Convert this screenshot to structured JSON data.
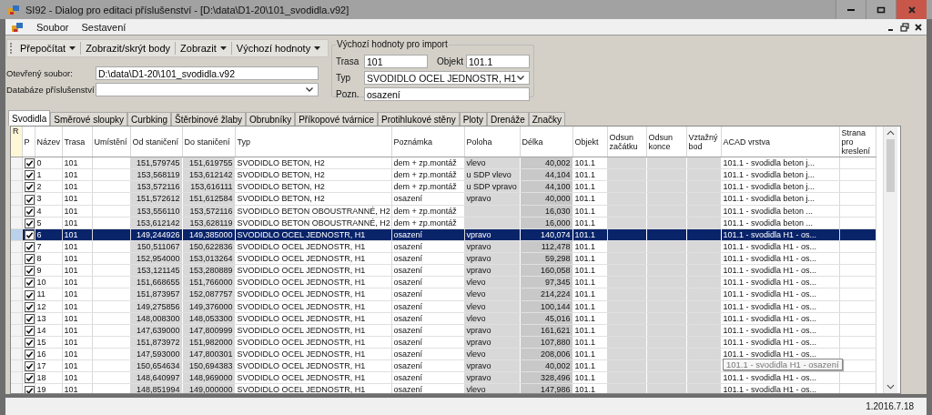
{
  "window": {
    "title": "SI92 - Dialog pro editaci příslušenství - [D:\\data\\D1-20\\101_svodidla.v92]"
  },
  "menu": [
    "Soubor",
    "Sestavení"
  ],
  "toolbar": [
    {
      "label": "Přepočítat",
      "dropdown": true
    },
    {
      "label": "Zobrazit/skrýt body",
      "dropdown": false
    },
    {
      "label": "Zobrazit",
      "dropdown": true
    },
    {
      "label": "Výchozí hodnoty",
      "dropdown": true
    }
  ],
  "fields": [
    {
      "label": "Otevřený soubor:",
      "value": "D:\\data\\D1-20\\101_svodidla.v92",
      "kind": "text"
    },
    {
      "label": "Databáze příslušenství",
      "kind": "combo"
    }
  ],
  "import_defaults": {
    "title": "Výchozí hodnoty pro import",
    "rows": [
      [
        {
          "label": "Trasa",
          "value": "101",
          "kind": "text"
        },
        {
          "label": "Objekt",
          "value": "101.1",
          "kind": "text"
        }
      ],
      [
        {
          "label": "Typ",
          "value": "SVODIDLO OCEL JEDNOSTR, H1",
          "kind": "combo"
        }
      ],
      [
        {
          "label": "Pozn.",
          "value": "osazení",
          "kind": "text"
        }
      ]
    ]
  },
  "tabs": [
    {
      "label": "Svodidla",
      "selected": true
    },
    {
      "label": "Směrové sloupky",
      "selected": false
    },
    {
      "label": "Curbking",
      "selected": false
    },
    {
      "label": "Štěrbinové žlaby",
      "selected": false
    },
    {
      "label": "Obrubníky",
      "selected": false
    },
    {
      "label": "Příkopové tvárnice",
      "selected": false
    },
    {
      "label": "Protihlukové stěny",
      "selected": false
    },
    {
      "label": "Ploty",
      "selected": false
    },
    {
      "label": "Drenáže",
      "selected": false
    },
    {
      "label": "Značky",
      "selected": false
    }
  ],
  "table": {
    "row_header_label": "R",
    "check_label": "P",
    "columns": [
      {
        "label": "Název",
        "kind": "text"
      },
      {
        "label": "Trasa",
        "kind": "text"
      },
      {
        "label": "Umístění",
        "kind": "text"
      },
      {
        "label": "Od staničení",
        "kind": "readonly-number"
      },
      {
        "label": "Do staničení",
        "kind": "readonly-number"
      },
      {
        "label": "Typ",
        "kind": "text"
      },
      {
        "label": "Poznámka",
        "kind": "text"
      },
      {
        "label": "Poloha",
        "kind": "readonly"
      },
      {
        "label": "Délka",
        "kind": "computed-number"
      },
      {
        "label": "Objekt",
        "kind": "text"
      },
      {
        "label": "Odsun začátku",
        "kind": "readonly"
      },
      {
        "label": "Odsun konce",
        "kind": "readonly"
      },
      {
        "label": "Vztažný bod",
        "kind": "readonly"
      },
      {
        "label": "ACAD vrstva",
        "kind": "text"
      },
      {
        "label": "Strana pro kreslení",
        "kind": "text"
      }
    ],
    "rows": [
      {
        "selected": false,
        "checked": true,
        "cells": [
          "0",
          "101",
          null,
          "151,579745",
          "151,619755",
          "SVODIDLO BETON, H2",
          "dem + zp.montáž",
          "vlevo",
          "40,002",
          "101.1",
          null,
          null,
          null,
          "101.1 - svodidla beton j...",
          null
        ]
      },
      {
        "selected": false,
        "checked": true,
        "cells": [
          "1",
          "101",
          null,
          "153,568119",
          "153,612142",
          "SVODIDLO BETON, H2",
          "dem + zp.montáž",
          "u SDP vlevo",
          "44,104",
          "101.1",
          null,
          null,
          null,
          "101.1 - svodidla beton j...",
          null
        ]
      },
      {
        "selected": false,
        "checked": true,
        "cells": [
          "2",
          "101",
          null,
          "153,572116",
          "153,616111",
          "SVODIDLO BETON, H2",
          "dem + zp.montáž",
          "u SDP vpravo",
          "44,100",
          "101.1",
          null,
          null,
          null,
          "101.1 - svodidla beton j...",
          null
        ]
      },
      {
        "selected": false,
        "checked": true,
        "cells": [
          "3",
          "101",
          null,
          "151,572612",
          "151,612584",
          "SVODIDLO BETON, H2",
          "osazení",
          "vpravo",
          "40,000",
          "101.1",
          null,
          null,
          null,
          "101.1 - svodidla beton j...",
          null
        ]
      },
      {
        "selected": false,
        "checked": true,
        "cells": [
          "4",
          "101",
          null,
          "153,556110",
          "153,572116",
          "SVODIDLO BETON OBOUSTRANNÉ, H2",
          "dem + zp.montáž",
          null,
          "16,030",
          "101.1",
          null,
          null,
          null,
          "101.1 - svodidla beton ...",
          null
        ]
      },
      {
        "selected": false,
        "checked": true,
        "cells": [
          "5",
          "101",
          null,
          "153,612142",
          "153,628119",
          "SVODIDLO BETON OBOUSTRANNÉ, H2",
          "dem + zp.montáž",
          null,
          "16,000",
          "101.1",
          null,
          null,
          null,
          "101.1 - svodidla beton ...",
          null
        ]
      },
      {
        "selected": true,
        "checked": true,
        "cells": [
          "6",
          "101",
          null,
          "149,244926",
          "149,385000",
          "SVODIDLO OCEL JEDNOSTR, H1",
          "osazení",
          "vpravo",
          "140,074",
          "101.1",
          null,
          null,
          null,
          "101.1 - svodidla H1 - os...",
          null
        ]
      },
      {
        "selected": false,
        "checked": true,
        "cells": [
          "7",
          "101",
          null,
          "150,511067",
          "150,622836",
          "SVODIDLO OCEL JEDNOSTR, H1",
          "osazení",
          "vpravo",
          "112,478",
          "101.1",
          null,
          null,
          null,
          "101.1 - svodidla H1 - os...",
          null
        ]
      },
      {
        "selected": false,
        "checked": true,
        "cells": [
          "8",
          "101",
          null,
          "152,954000",
          "153,013264",
          "SVODIDLO OCEL JEDNOSTR, H1",
          "osazení",
          "vpravo",
          "59,298",
          "101.1",
          null,
          null,
          null,
          "101.1 - svodidla H1 - os...",
          null
        ]
      },
      {
        "selected": false,
        "checked": true,
        "cells": [
          "9",
          "101",
          null,
          "153,121145",
          "153,280889",
          "SVODIDLO OCEL JEDNOSTR, H1",
          "osazení",
          "vpravo",
          "160,058",
          "101.1",
          null,
          null,
          null,
          "101.1 - svodidla H1 - os...",
          null
        ]
      },
      {
        "selected": false,
        "checked": true,
        "cells": [
          "10",
          "101",
          null,
          "151,668655",
          "151,766000",
          "SVODIDLO OCEL JEDNOSTR, H1",
          "osazení",
          "vlevo",
          "97,345",
          "101.1",
          null,
          null,
          null,
          "101.1 - svodidla H1 - os...",
          null
        ]
      },
      {
        "selected": false,
        "checked": true,
        "cells": [
          "11",
          "101",
          null,
          "151,873957",
          "152,087757",
          "SVODIDLO OCEL JEDNOSTR, H1",
          "osazení",
          "vlevo",
          "214,224",
          "101.1",
          null,
          null,
          null,
          "101.1 - svodidla H1 - os...",
          null
        ]
      },
      {
        "selected": false,
        "checked": true,
        "cells": [
          "12",
          "101",
          null,
          "149,275856",
          "149,376000",
          "SVODIDLO OCEL JEDNOSTR, H1",
          "osazení",
          "vlevo",
          "100,144",
          "101.1",
          null,
          null,
          null,
          "101.1 - svodidla H1 - os...",
          null
        ]
      },
      {
        "selected": false,
        "checked": true,
        "cells": [
          "13",
          "101",
          null,
          "148,008300",
          "148,053300",
          "SVODIDLO OCEL JEDNOSTR, H1",
          "osazení",
          "vlevo",
          "45,016",
          "101.1",
          null,
          null,
          null,
          "101.1 - svodidla H1 - os...",
          null
        ]
      },
      {
        "selected": false,
        "checked": true,
        "cells": [
          "14",
          "101",
          null,
          "147,639000",
          "147,800999",
          "SVODIDLO OCEL JEDNOSTR, H1",
          "osazení",
          "vpravo",
          "161,621",
          "101.1",
          null,
          null,
          null,
          "101.1 - svodidla H1 - os...",
          null
        ]
      },
      {
        "selected": false,
        "checked": true,
        "cells": [
          "15",
          "101",
          null,
          "151,873972",
          "151,982000",
          "SVODIDLO OCEL JEDNOSTR, H1",
          "osazení",
          "vpravo",
          "107,880",
          "101.1",
          null,
          null,
          null,
          "101.1 - svodidla H1 - os...",
          null
        ]
      },
      {
        "selected": false,
        "checked": true,
        "cells": [
          "16",
          "101",
          null,
          "147,593000",
          "147,800301",
          "SVODIDLO OCEL JEDNOSTR, H1",
          "osazení",
          "vlevo",
          "208,006",
          "101.1",
          null,
          null,
          null,
          "101.1 - svodidla H1 - os...",
          null
        ]
      },
      {
        "selected": false,
        "checked": true,
        "cells": [
          "17",
          "101",
          null,
          "150,654634",
          "150,694383",
          "SVODIDLO OCEL JEDNOSTR, H1",
          "osazení",
          "vpravo",
          "40,002",
          "101.1",
          null,
          null,
          null,
          null,
          null
        ]
      },
      {
        "selected": false,
        "checked": true,
        "cells": [
          "18",
          "101",
          null,
          "148,640997",
          "148,969000",
          "SVODIDLO OCEL JEDNOSTR, H1",
          "osazení",
          "vpravo",
          "328,496",
          "101.1",
          null,
          null,
          null,
          "101.1 - svodidla H1 - os...",
          null
        ]
      },
      {
        "selected": false,
        "checked": true,
        "cells": [
          "19",
          "101",
          null,
          "148,851994",
          "149,000000",
          "SVODIDLO OCEL JEDNOSTR, H1",
          "osazení",
          "vlevo",
          "147,986",
          "101.1",
          null,
          null,
          null,
          "101.1 - svodidla H1 - os...",
          null
        ]
      }
    ]
  },
  "tooltip": "101.1 - svodidla H1 - osazení",
  "status_bar": {
    "version": "1.2016.7.18"
  }
}
